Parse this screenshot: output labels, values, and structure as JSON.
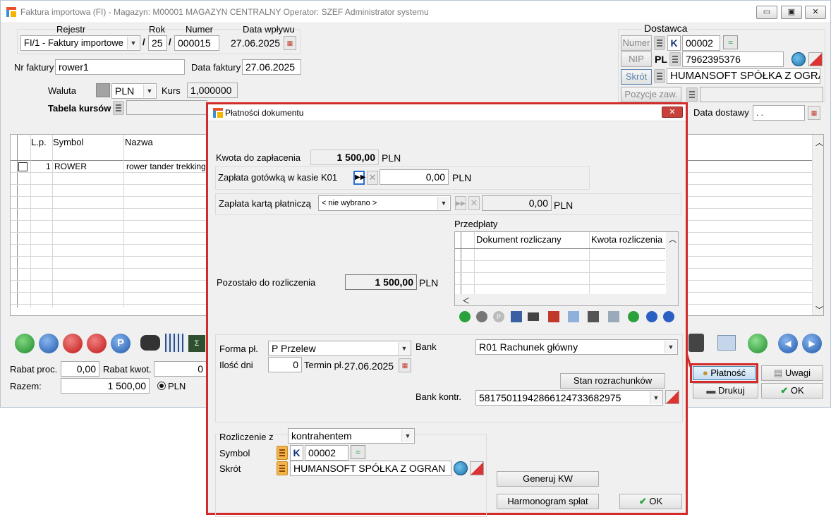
{
  "window": {
    "title": "Faktura importowa (FI) - Magazyn: M00001 MAGAZYN CENTRALNY  Operator: SZEF Administrator systemu",
    "min": "▭",
    "max": "▣",
    "close": "✕"
  },
  "header": {
    "rejestr_label": "Rejestr",
    "rok_label": "Rok",
    "numer_label": "Numer",
    "data_wplywu_label": "Data wpływu",
    "rejestr_value": "FI/1   - Faktury importowe",
    "slash": "/",
    "rok_value": "25",
    "numer_value": "000015",
    "data_wplywu_value": "27.06.2025",
    "nr_faktury_label": "Nr faktury",
    "nr_faktury_value": "rower1",
    "data_faktury_label": "Data faktury",
    "data_faktury_value": "27.06.2025",
    "waluta_label": "Waluta",
    "waluta_value": "PLN",
    "kurs_label": "Kurs",
    "kurs_value": "1,000000",
    "tabela_kursow_label": "Tabela kursów"
  },
  "dostawca": {
    "title": "Dostawca",
    "numer_btn": "Numer",
    "k": "K",
    "numer_value": "00002",
    "nip_btn": "NIP",
    "pl": "PL",
    "nip_value": "7962395376",
    "skrot_btn": "Skrót",
    "skrot_value": "HUMANSOFT SPÓŁKA Z OGRAN",
    "pozycje_btn": "Pozycje zaw.",
    "data_dostawy_label": "Data dostawy",
    "data_dostawy_value": " .  ."
  },
  "table": {
    "headers": [
      "L.p.",
      "Symbol",
      "Nazwa"
    ],
    "rows": [
      {
        "lp": "1",
        "symbol": "ROWER",
        "nazwa": "rower tander trekking"
      }
    ]
  },
  "totals": {
    "rabat_proc_label": "Rabat proc.",
    "rabat_proc_value": "0,00",
    "rabat_kwot_label": "Rabat kwot.",
    "rabat_kwot_value": "0",
    "razem_label": "Razem:",
    "razem_value": "1 500,00",
    "currency": "PLN"
  },
  "right_buttons": {
    "platnosc": "Płatność",
    "uwagi": "Uwagi",
    "drukuj": "Drukuj",
    "ok": "OK"
  },
  "dialog": {
    "title": "Płatności dokumentu",
    "kwota_label": "Kwota do zapłacenia",
    "kwota_value": "1 500,00",
    "currency": "PLN",
    "gotowka_label": "Zapłata gotówką w kasie K01",
    "gotowka_value": "0,00",
    "karta_label": "Zapłata kartą płatniczą",
    "karta_select": "< nie wybrano >",
    "karta_value": "0,00",
    "przedplaty_label": "Przedpłaty",
    "przedplaty_headers": [
      "Dokument rozliczany",
      "Kwota rozliczenia"
    ],
    "pozostalo_label": "Pozostało do rozliczenia",
    "pozostalo_value": "1 500,00",
    "forma_label": "Forma pł.",
    "forma_value": "P  Przelew",
    "bank_label": "Bank",
    "bank_value": "R01 Rachunek główny",
    "ilosc_dni_label": "Ilość dni",
    "ilosc_dni_value": "0",
    "termin_label": "Termin pł.",
    "termin_value": "27.06.2025",
    "stan_btn": "Stan rozrachunków",
    "bank_kontr_label": "Bank kontr.",
    "bank_kontr_value": "58175011942866124733682975",
    "rozliczenie_label": "Rozliczenie z",
    "rozliczenie_value": "kontrahentem",
    "symbol_label": "Symbol",
    "k": "K",
    "symbol_value": "00002",
    "skrot_label": "Skrót",
    "skrot_value": "HUMANSOFT SPÓŁKA Z OGRAN",
    "generuj_btn": "Generuj KW",
    "harmonogram_btn": "Harmonogram spłat",
    "ok_btn": "OK"
  }
}
